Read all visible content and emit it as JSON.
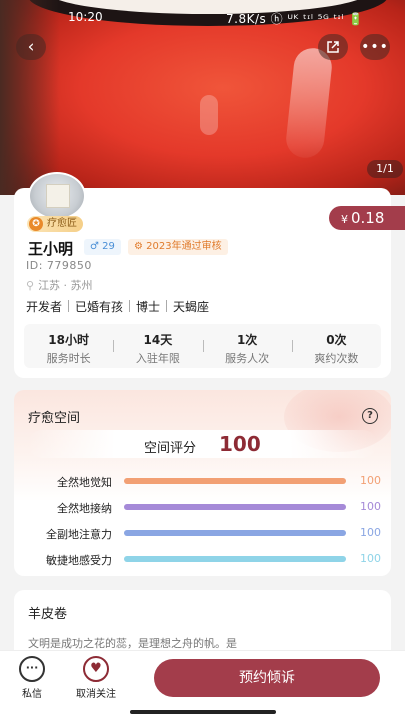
{
  "status_bar": {
    "time": "10:20",
    "network": "7.8K/s ⓗ ᵁᴷ ᵗᶦˡ ⁵ᴳ ᵗᶦˡ 🔋"
  },
  "header": {
    "image_counter": "1/1"
  },
  "profile": {
    "badge": "疗愈匠",
    "price_symbol": "¥",
    "price": "0.18",
    "name": "王小明",
    "fans": "♂ 29",
    "verified": "2023年通过审核",
    "id": "ID:  779850",
    "location": "江苏 · 苏州",
    "tags": [
      "开发者",
      "已婚有孩",
      "博士",
      "天蝎座"
    ],
    "stats": [
      {
        "value": "18小时",
        "label": "服务时长"
      },
      {
        "value": "14天",
        "label": "入驻年限"
      },
      {
        "value": "1次",
        "label": "服务人次"
      },
      {
        "value": "0次",
        "label": "爽约次数"
      }
    ]
  },
  "healing_space": {
    "title": "疗愈空间",
    "score_label": "空间评分",
    "score": "100",
    "metrics": [
      {
        "label": "全然地觉知",
        "value": "100",
        "level": 1.0,
        "color": "#f2a074"
      },
      {
        "label": "全然地接纳",
        "value": "100",
        "level": 1.0,
        "color": "#a58ad8"
      },
      {
        "label": "全副地注意力",
        "value": "100",
        "level": 1.0,
        "color": "#8aa6e3"
      },
      {
        "label": "敏捷地感受力",
        "value": "100",
        "level": 1.0,
        "color": "#8fd4e8"
      }
    ]
  },
  "parchment": {
    "title": "羊皮卷",
    "text": "文明是成功之花的蕊，是理想之舟的帆。是"
  },
  "bottom_bar": {
    "message_label": "私信",
    "unfollow_label": "取消关注",
    "book_label": "预约倾诉"
  },
  "colors": {
    "accent": "#a33d4b",
    "score": "#8d2b35"
  }
}
